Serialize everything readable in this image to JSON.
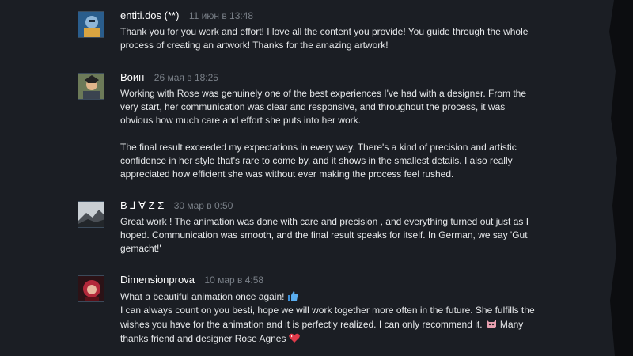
{
  "comments": [
    {
      "author": "entiti.dos (**)",
      "timestamp": "11 июн в 13:48",
      "avatar_icon": "knight-avatar",
      "lines": [
        "Thank you for you work and effort! I love all the content you provide! You guide through the whole",
        "process of creating an artwork! Thanks for the amazing artwork!"
      ]
    },
    {
      "author": "Воин",
      "timestamp": "26 мая в 18:25",
      "avatar_icon": "warrior-avatar",
      "lines": [
        "Working with Rose was genuinely one of the best experiences I've had with a designer. From the",
        "very start, her communication was clear and responsive, and throughout the process, it was",
        "obvious how much care and effort she puts into her work.",
        "The final result exceeded my expectations in every way. There's a kind of precision and artistic",
        "confidence in her style that's rare to come by, and it shows in the smallest details. I also really",
        "appreciated how efficient she was without ever making the process feel rushed."
      ]
    },
    {
      "author": "B ⅃ ∀ Z Σ",
      "timestamp": "30 мар в 0:50",
      "avatar_icon": "landscape-avatar",
      "lines": [
        "Great work ! The animation was done with care and precision , and everything turned out just as I",
        "hoped. Communication was smooth, and the final result speaks for itself. In German, we say 'Gut",
        "gemacht!'"
      ]
    },
    {
      "author": "Dimensionprova",
      "timestamp": "10 мар в 4:58",
      "avatar_icon": "red-hair-avatar",
      "lines": [
        "What a beautiful animation once again!",
        "I can always count on you besti, hope we will work together more often in the future. She fulfills the",
        "wishes you have for the animation and it is perfectly realized. I can only recommend it.",
        "Many",
        "thanks friend and designer Rose Agnes"
      ]
    }
  ],
  "colors": {
    "panel": "#1b1e24",
    "author": "#ffffff",
    "timestamp": "#7a8088",
    "text": "#e6e8ea"
  }
}
